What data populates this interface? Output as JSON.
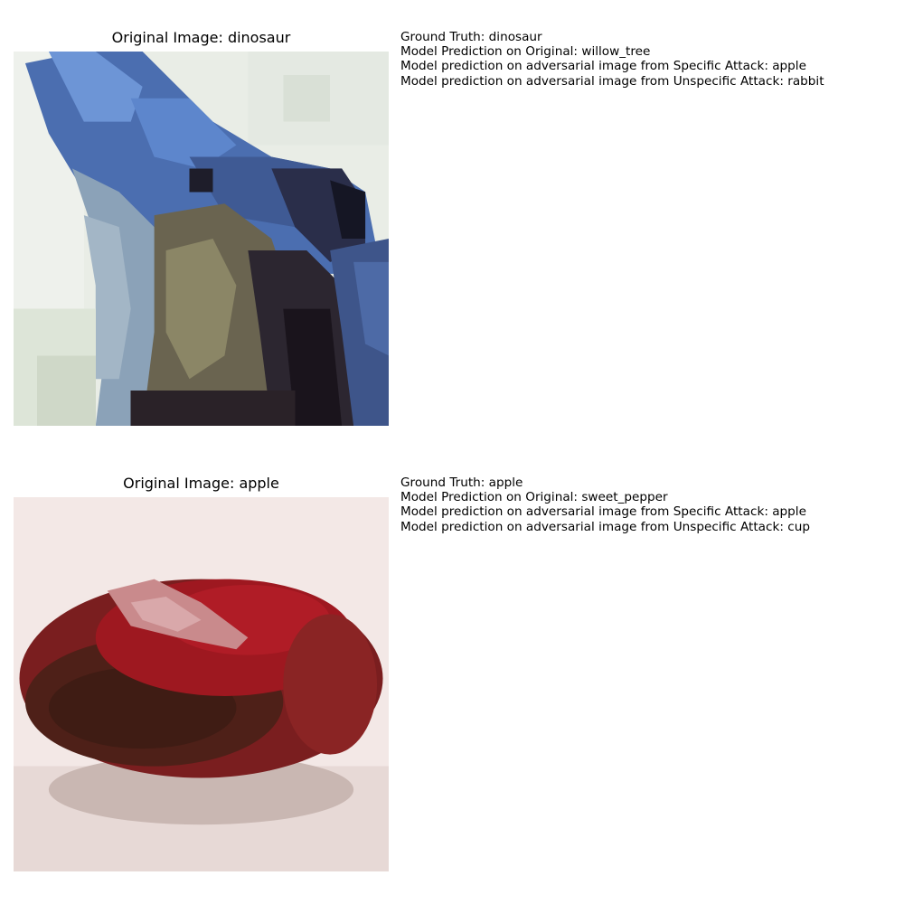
{
  "samples": [
    {
      "title": "Original Image: dinosaur",
      "ground_truth": "Ground Truth: dinosaur",
      "pred_original": "Model Prediction on Original: willow_tree",
      "pred_specific": "Model prediction on adversarial image from Specific Attack: apple",
      "pred_unspecific": "Model prediction on adversarial image from Unspecific Attack: rabbit"
    },
    {
      "title": "Original Image: apple",
      "ground_truth": "Ground Truth: apple",
      "pred_original": "Model Prediction on Original: sweet_pepper",
      "pred_specific": "Model prediction on adversarial image from Specific Attack: apple",
      "pred_unspecific": "Model prediction on adversarial image from Unspecific Attack: cup"
    }
  ]
}
